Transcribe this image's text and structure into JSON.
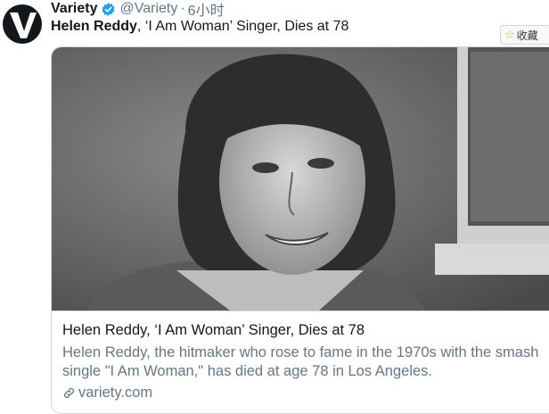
{
  "tweet": {
    "avatar_icon": "variety-logo-icon",
    "display_name": "Variety",
    "handle": "@Variety",
    "separator": "·",
    "timestamp": "6小时",
    "text_bold": "Helen Reddy",
    "text_rest": ", ‘I Am Woman’ Singer, Dies at 78"
  },
  "bookmark": {
    "icon": "star-icon",
    "label": "收藏"
  },
  "card": {
    "image": "black-and-white-portrait-photo",
    "title": "Helen Reddy, ‘I Am Woman’ Singer, Dies at 78",
    "description": "Helen Reddy, the hitmaker who rose to fame in the 1970s with the smash single \"I Am Woman,\" has died at age 78 in Los Angeles.",
    "domain_icon": "link-icon",
    "domain": "variety.com"
  },
  "colors": {
    "verified": "#1da1f2",
    "secondary_text": "#657786",
    "border": "#cfd9de"
  }
}
